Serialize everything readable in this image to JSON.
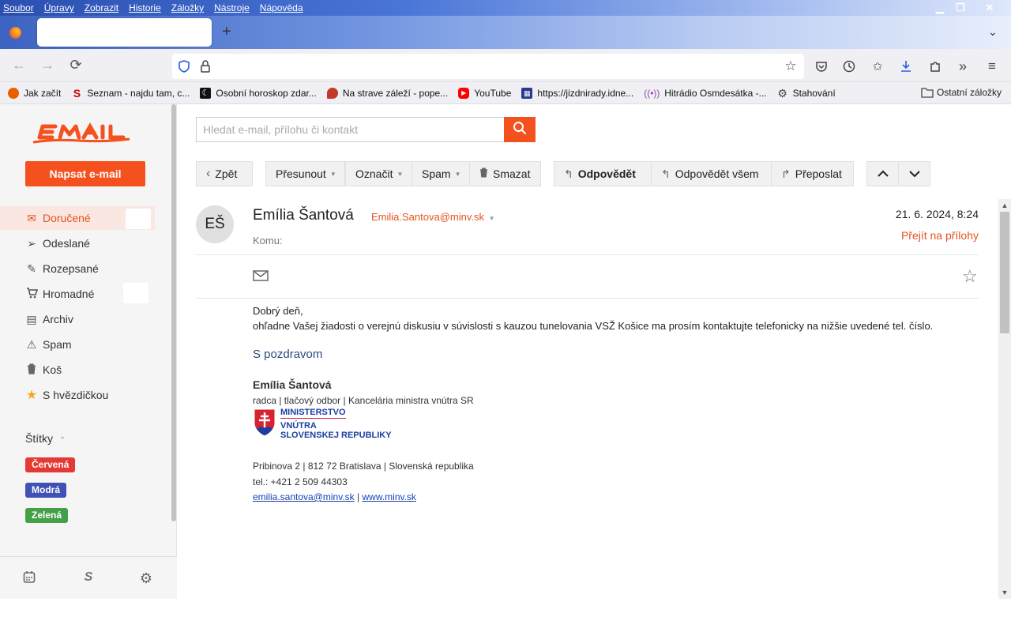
{
  "window": {
    "menu": [
      "Soubor",
      "Úpravy",
      "Zobrazit",
      "Historie",
      "Záložky",
      "Nástroje",
      "Nápověda"
    ],
    "controls": {
      "minimize": "▁",
      "restore": "❐",
      "close": "✕"
    }
  },
  "tabs": {
    "new_tab": "+",
    "menu": "⌄"
  },
  "nav": {
    "back": "←",
    "forward": "→",
    "reload": "⟳",
    "url": ""
  },
  "bookmarks": [
    {
      "label": "Jak začít",
      "icon": "firefox-icon",
      "color": "#e66000"
    },
    {
      "label": "Seznam - najdu tam, c...",
      "icon": "seznam-icon",
      "color": "#cc0000"
    },
    {
      "label": "Osobní horoskop zdar...",
      "icon": "horoscope-icon",
      "color": "#111111"
    },
    {
      "label": "Na strave záleží - pope...",
      "icon": "strava-icon",
      "color": "#c0392b"
    },
    {
      "label": "YouTube",
      "icon": "youtube-icon",
      "color": "#ff0000"
    },
    {
      "label": "https://jizdnirady.idne...",
      "icon": "timetable-icon",
      "color": "#2a3a8c"
    },
    {
      "label": "Hitrádio Osmdesátka -...",
      "icon": "radio-icon",
      "color": "#8e44ad"
    },
    {
      "label": "Stahování",
      "icon": "gear-icon",
      "color": "#444444"
    }
  ],
  "other_bookmarks": "Ostatní záložky",
  "sidebar": {
    "compose": "Napsat e-mail",
    "folders": [
      {
        "label": "Doručené",
        "icon": "envelope-icon",
        "glyph": "✉",
        "active": true
      },
      {
        "label": "Odeslané",
        "icon": "send-icon",
        "glyph": "➢",
        "active": false
      },
      {
        "label": "Rozepsané",
        "icon": "draft-icon",
        "glyph": "✎",
        "active": false
      },
      {
        "label": "Hromadné",
        "icon": "cart-icon",
        "glyph": "🛒",
        "active": false
      },
      {
        "label": "Archiv",
        "icon": "archive-icon",
        "glyph": "▤",
        "active": false
      },
      {
        "label": "Spam",
        "icon": "warning-icon",
        "glyph": "⚠",
        "active": false
      },
      {
        "label": "Koš",
        "icon": "trash-icon",
        "glyph": "🗑",
        "active": false
      },
      {
        "label": "S hvězdičkou",
        "icon": "star-icon",
        "glyph": "★",
        "active": false
      }
    ],
    "labels_header": "Štítky",
    "labels": [
      {
        "label": "Červená",
        "color": "#e53935"
      },
      {
        "label": "Modrá",
        "color": "#3f51b5"
      },
      {
        "label": "Zelená",
        "color": "#43a047"
      }
    ]
  },
  "search": {
    "placeholder": "Hledat e-mail, přílohu či kontakt"
  },
  "toolbar": {
    "back": "Zpět",
    "move": "Přesunout",
    "mark": "Označit",
    "spam": "Spam",
    "delete": "Smazat",
    "reply": "Odpovědět",
    "reply_all": "Odpovědět všem",
    "forward": "Přeposlat"
  },
  "message": {
    "avatar_initials": "EŠ",
    "sender_name": "Emília Šantová",
    "sender_email": "Emilia.Santova@minv.sk",
    "to_label": "Komu:",
    "date": "21. 6. 2024, 8:24",
    "attachments_link": "Přejít na přílohy",
    "greeting": "Dobrý deň,",
    "body": "ohľadne Vašej žiadosti o verejnú diskusiu v súvislosti s kauzou tunelovania VSŽ Košice ma prosím kontaktujte telefonicky na nižšie uvedené tel. číslo.",
    "closing": "S pozdravom",
    "signature": {
      "name": "Emília Šantová",
      "role": "radca | tlačový odbor | Kancelária ministra vnútra SR",
      "logo_line1": "MINISTERSTVO",
      "logo_line2": "VNÚTRA",
      "logo_line3": "SLOVENSKEJ REPUBLIKY",
      "address": "Pribinova 2 | 812 72 Bratislava | Slovenská republika",
      "phone": "tel.: +421 2 509 44303",
      "email_link": "emilia.santova@minv.sk",
      "separator": "|",
      "web_link": "www.minv.sk"
    }
  },
  "colors": {
    "accent": "#f4511e",
    "link": "#e2531e",
    "active_bg": "#fbe7e1"
  }
}
